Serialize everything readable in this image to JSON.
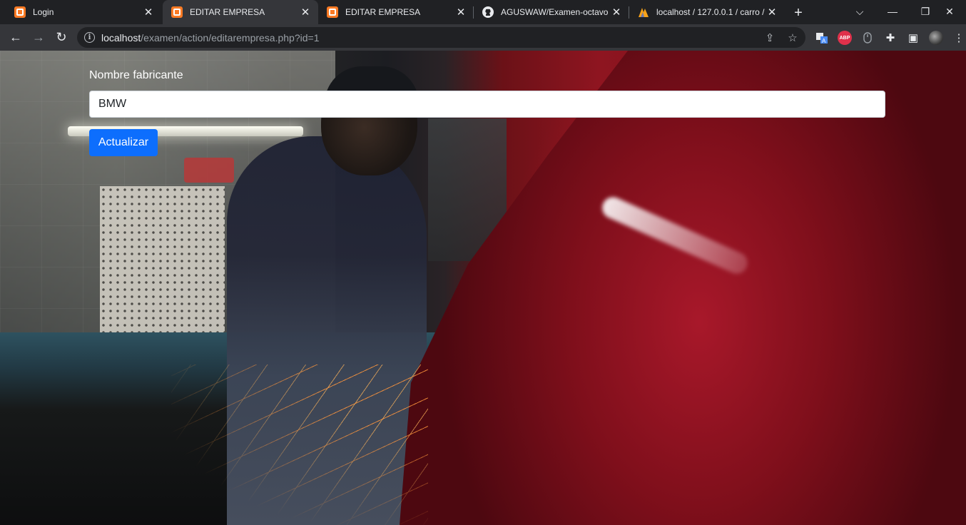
{
  "browser": {
    "tabs": [
      {
        "title": "Login",
        "icon": "xampp-icon",
        "active": false
      },
      {
        "title": "EDITAR EMPRESA",
        "icon": "xampp-icon",
        "active": true
      },
      {
        "title": "EDITAR EMPRESA",
        "icon": "xampp-icon",
        "active": false
      },
      {
        "title": "AGUSWAW/Examen-octavo",
        "icon": "github-icon",
        "active": false
      },
      {
        "title": "localhost / 127.0.0.1 / carro /",
        "icon": "phpmyadmin-icon",
        "active": false
      }
    ],
    "new_tab_glyph": "+",
    "close_glyph": "✕",
    "url_host": "localhost",
    "url_path": "/examen/action/editarempresa.php?id=1",
    "window_controls": {
      "tab_search": "⌵",
      "minimize": "—",
      "restore": "❐",
      "close": "✕"
    },
    "toolbar_icons": {
      "back": "←",
      "forward": "→",
      "reload": "↻",
      "share": "⇪",
      "bookmark": "☆",
      "extensions": "✚",
      "sidebar": "▣",
      "menu": "⋮",
      "info": "i",
      "abp": "ABP"
    }
  },
  "form": {
    "label": "Nombre fabricante",
    "input_value": "BMW",
    "submit_label": "Actualizar"
  },
  "colors": {
    "button_primary": "#0d6efd",
    "browser_frame": "#202124",
    "toolbar": "#35363a"
  }
}
